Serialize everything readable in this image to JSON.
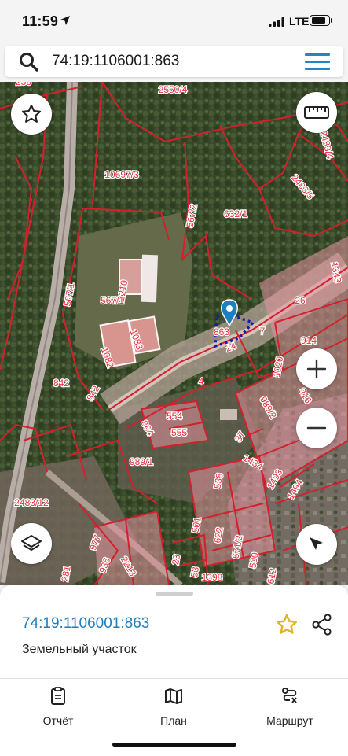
{
  "status_bar": {
    "time": "11:59",
    "network": "LTE"
  },
  "search": {
    "query": "74:19:1106001:863"
  },
  "map": {
    "parcel_labels": [
      "258",
      "2550/4",
      "2483/4",
      "10697/3",
      "2483/5",
      "632/1",
      "567/2",
      "1343",
      "2210",
      "567/1",
      "26",
      "567/1",
      "863",
      "7",
      "1083",
      "1082",
      "24",
      "914",
      "1020",
      "842",
      "4",
      "842",
      "916",
      "989/2",
      "864",
      "554",
      "555",
      "37",
      "1434",
      "989/1",
      "1493",
      "538",
      "1494",
      "2483/12",
      "501",
      "622",
      "671/2",
      "977",
      "500",
      "23",
      "53",
      "936",
      "2213",
      "612",
      "1398",
      "281"
    ]
  },
  "sheet": {
    "cadastral_number": "74:19:1106001:863",
    "type": "Земельный участок"
  },
  "tabs": [
    {
      "label": "Отчёт",
      "icon": "report-icon"
    },
    {
      "label": "План",
      "icon": "map-plan-icon"
    },
    {
      "label": "Маршрут",
      "icon": "route-icon"
    }
  ],
  "colors": {
    "accent": "#1e7fbf",
    "parcel_border": "#d3202d",
    "selection": "#1a1aa8",
    "star": "#e2b51a"
  }
}
